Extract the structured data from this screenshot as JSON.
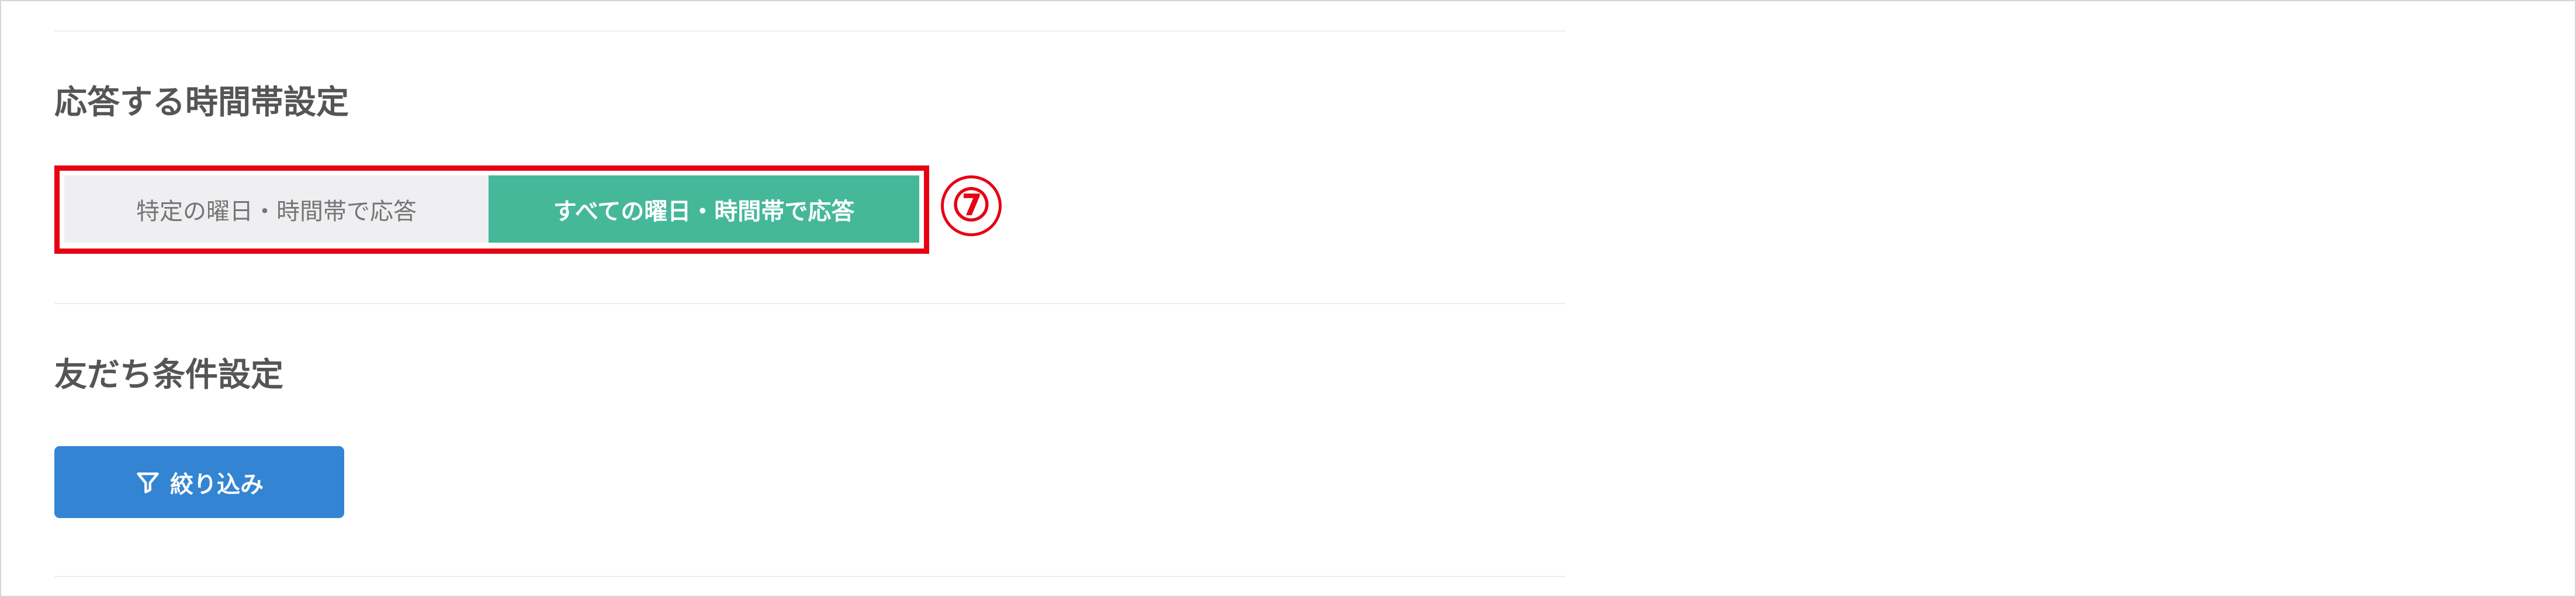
{
  "response_time": {
    "title": "応答する時間帯設定",
    "toggle_options": [
      {
        "label": "特定の曜日・時間帯で応答",
        "selected": false
      },
      {
        "label": "すべての曜日・時間帯で応答",
        "selected": true
      }
    ],
    "annotation_marker": "⑦",
    "selected_color": "#45b89a",
    "highlight_color": "#e60012"
  },
  "friend_conditions": {
    "title": "友だち条件設定",
    "filter_button": {
      "label": "絞り込み",
      "icon": "filter-icon",
      "color": "#3385d3"
    }
  }
}
